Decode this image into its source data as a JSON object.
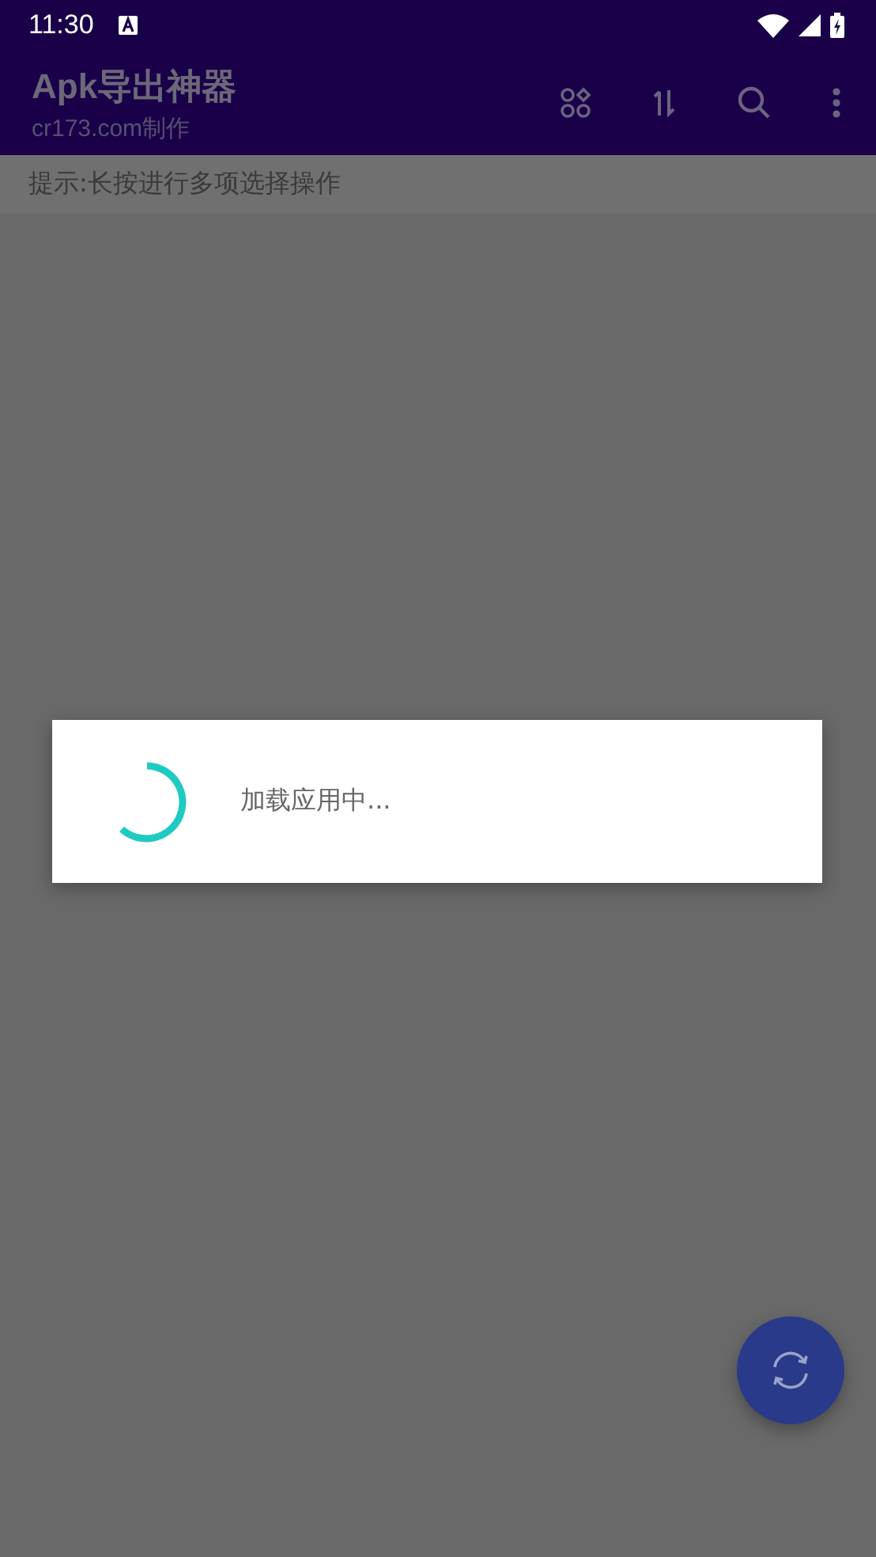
{
  "status_bar": {
    "time": "11:30"
  },
  "app_bar": {
    "title": "Apk导出神器",
    "subtitle": "cr173.com制作"
  },
  "hint": "提示:长按进行多项选择操作",
  "dialog": {
    "message": "加载应用中..."
  }
}
